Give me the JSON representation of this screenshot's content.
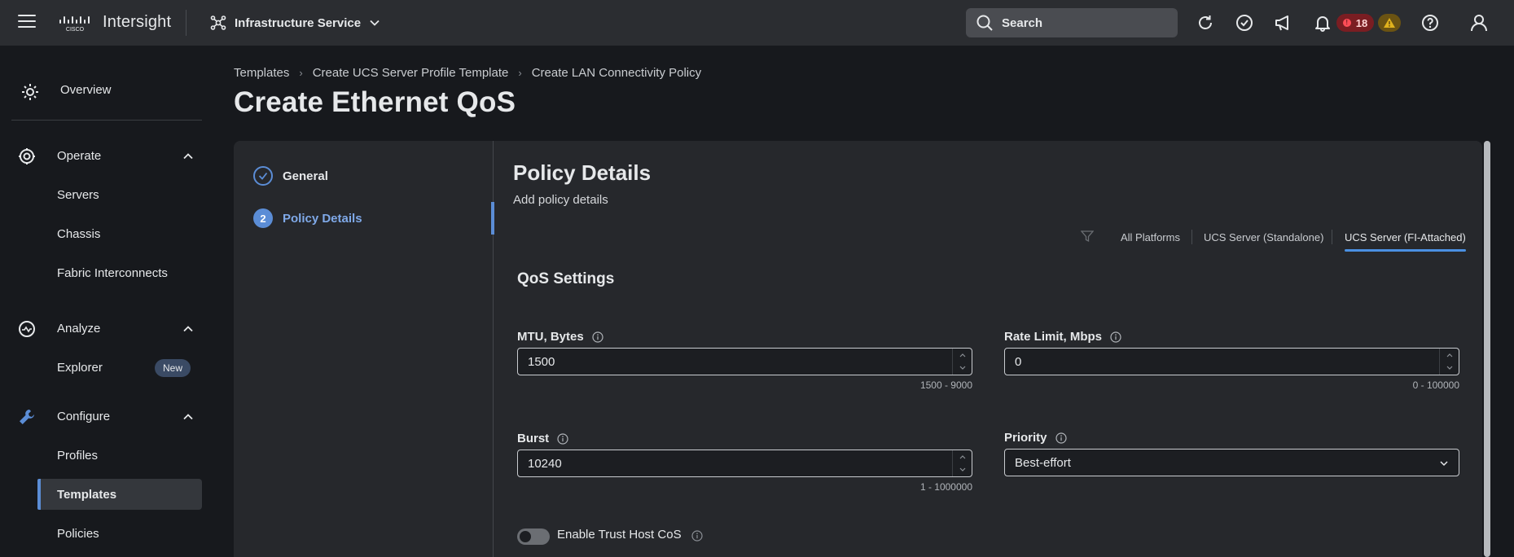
{
  "app": {
    "brand": "Intersight",
    "service": "Infrastructure Service"
  },
  "search": {
    "placeholder": "Search"
  },
  "alerts": {
    "error_count": "18"
  },
  "sidebar": {
    "overview": "Overview",
    "operate": {
      "label": "Operate",
      "items": [
        "Servers",
        "Chassis",
        "Fabric Interconnects"
      ]
    },
    "analyze": {
      "label": "Analyze",
      "items": [
        "Explorer"
      ],
      "badge": "New"
    },
    "configure": {
      "label": "Configure",
      "items": [
        "Profiles",
        "Templates",
        "Policies"
      ],
      "active": "Templates"
    }
  },
  "breadcrumb": [
    "Templates",
    "Create UCS Server Profile Template",
    "Create LAN Connectivity Policy"
  ],
  "page_title": "Create Ethernet QoS",
  "steps": [
    {
      "number": "",
      "label": "General",
      "state": "done"
    },
    {
      "number": "2",
      "label": "Policy Details",
      "state": "current"
    }
  ],
  "policy_details": {
    "title": "Policy Details",
    "subtitle": "Add policy details",
    "platform_tabs": [
      "All Platforms",
      "UCS Server (Standalone)",
      "UCS Server (FI-Attached)"
    ],
    "active_tab": "UCS Server (FI-Attached)"
  },
  "qos": {
    "title": "QoS Settings",
    "mtu": {
      "label": "MTU, Bytes",
      "value": "1500",
      "range": "1500 - 9000"
    },
    "rate_limit": {
      "label": "Rate Limit, Mbps",
      "value": "0",
      "range": "0 - 100000"
    },
    "burst": {
      "label": "Burst",
      "value": "10240",
      "range": "1 - 1000000"
    },
    "priority": {
      "label": "Priority",
      "value": "Best-effort"
    },
    "trust_host_cos": {
      "label": "Enable Trust Host CoS",
      "enabled": false
    }
  },
  "colors": {
    "accent": "#5b8dd6",
    "tab_underline": "#4a90e2",
    "error": "#ff4d57",
    "warning": "#e0b21d"
  }
}
